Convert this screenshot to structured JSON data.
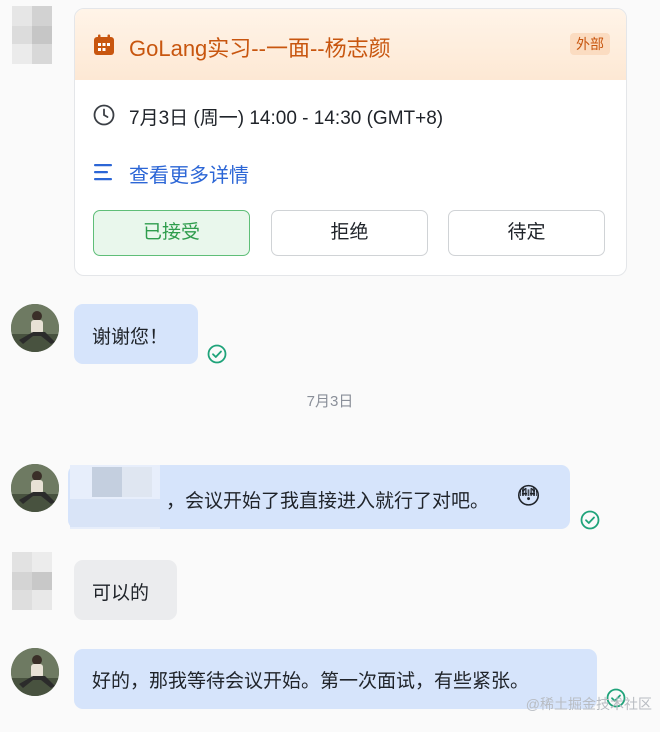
{
  "meeting_card": {
    "title": "GoLang实习--一面--杨志颜",
    "tag": "外部",
    "time": "7月3日 (周一) 14:00 - 14:30 (GMT+8)",
    "details_link": "查看更多详情",
    "buttons": {
      "accepted": "已接受",
      "decline": "拒绝",
      "tentative": "待定"
    },
    "accent_color": "#c8560f"
  },
  "messages": [
    {
      "from": "me",
      "text": "谢谢您！",
      "read": true
    },
    {
      "from": "me",
      "text": "，会议开始了我直接进入就行了对吧。",
      "emoji": "😳",
      "read": true
    },
    {
      "from": "other",
      "text": "可以的"
    },
    {
      "from": "me",
      "text": "好的，那我等待会议开始。第一次面试，有些紧张。",
      "read": true
    }
  ],
  "date_separator": "7月3日",
  "watermark": "@稀土掘金技术社区",
  "icons": [
    "calendar-icon",
    "clock-icon",
    "list-icon",
    "read-check-icon"
  ]
}
